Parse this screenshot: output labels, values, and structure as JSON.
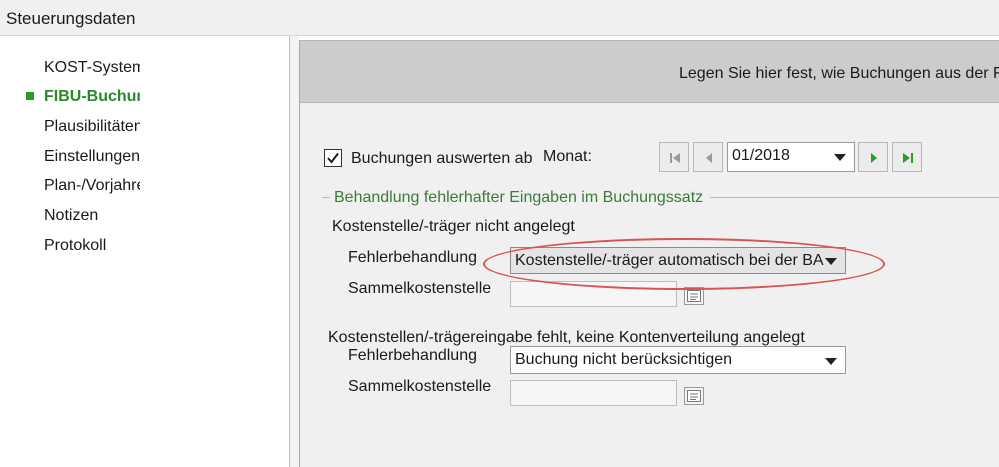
{
  "window": {
    "title": "Steuerungsdaten"
  },
  "sidebar": {
    "items": [
      {
        "label": "KOST-System",
        "active": false
      },
      {
        "label": "FIBU-Buchungen",
        "active": true
      },
      {
        "label": "Plausibilitäten",
        "active": false
      },
      {
        "label": "Einstellungen",
        "active": false
      },
      {
        "label": "Plan-/Vorjahre",
        "active": false
      },
      {
        "label": "Notizen",
        "active": false
      },
      {
        "label": "Protokoll",
        "active": false
      }
    ]
  },
  "header": {
    "text": "Legen Sie hier fest, wie Buchungen aus der F"
  },
  "period": {
    "checkbox_label": "Buchungen auswerten ab",
    "checked": true,
    "month_label": "Monat:",
    "month_value": "01/2018"
  },
  "group": {
    "title": "Behandlung fehlerhafter Eingaben im Buchungssatz",
    "section1": {
      "heading": "Kostenstelle/-träger nicht angelegt",
      "error_label": "Fehlerbehandlung",
      "error_value": "Kostenstelle/-träger automatisch bei der BA",
      "collective_label": "Sammelkostenstelle",
      "collective_value": ""
    },
    "section2": {
      "heading": "Kostenstellen/-trägereingabe fehlt, keine Kontenverteilung angelegt",
      "error_label": "Fehlerbehandlung",
      "error_value": "Buchung nicht berücksichtigen",
      "collective_label": "Sammelkostenstelle",
      "collective_value": ""
    }
  },
  "colors": {
    "accent_green": "#2a8a2a",
    "highlight_red": "#d9534f"
  }
}
